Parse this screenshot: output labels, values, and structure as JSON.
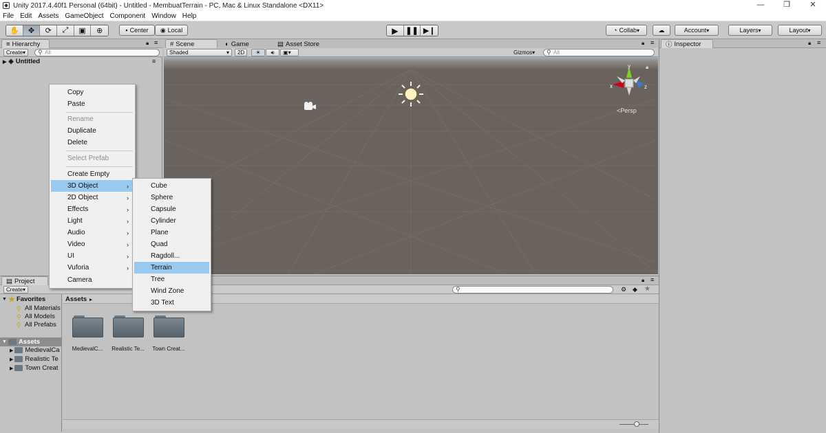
{
  "window": {
    "title": "Unity 2017.4.40f1 Personal (64bit) - Untitled - MembuatTerrain - PC, Mac & Linux Standalone <DX11>"
  },
  "menubar": [
    "File",
    "Edit",
    "Assets",
    "GameObject",
    "Component",
    "Window",
    "Help"
  ],
  "toolbar": {
    "pivot_center": "Center",
    "pivot_local": "Local",
    "collab": "Collab",
    "account": "Account",
    "layers": "Layers",
    "layout": "Layout"
  },
  "hierarchy": {
    "tab": "Hierarchy",
    "create": "Create",
    "search_placeholder": "All",
    "scene_name": "Untitled"
  },
  "scene_view": {
    "tab_scene": "Scene",
    "tab_game": "Game",
    "tab_asset_store": "Asset Store",
    "shading_mode": "Shaded",
    "mode_2d": "2D",
    "gizmos": "Gizmos",
    "search_placeholder": "All",
    "persp_label": "Persp",
    "gizmo_axes": {
      "x": "x",
      "y": "y",
      "z": "z"
    }
  },
  "inspector": {
    "tab": "Inspector"
  },
  "project": {
    "tab": "Project",
    "create": "Create",
    "favorites_label": "Favorites",
    "favorites": [
      "All Materials",
      "All Models",
      "All Prefabs"
    ],
    "assets_label": "Assets",
    "asset_tree": [
      "MedievalCa",
      "Realistic Te",
      "Town Creat"
    ],
    "breadcrumb": "Assets",
    "folders": [
      "MedievalC...",
      "Realistic Te...",
      "Town Creat..."
    ]
  },
  "context_menu": {
    "items": [
      {
        "label": "Copy"
      },
      {
        "label": "Paste"
      },
      {
        "label": "Rename",
        "disabled": true
      },
      {
        "label": "Duplicate"
      },
      {
        "label": "Delete"
      },
      {
        "label": "Select Prefab",
        "disabled": true
      },
      {
        "label": "Create Empty"
      },
      {
        "label": "3D Object",
        "submenu": true,
        "highlighted": true
      },
      {
        "label": "2D Object",
        "submenu": true
      },
      {
        "label": "Effects",
        "submenu": true
      },
      {
        "label": "Light",
        "submenu": true
      },
      {
        "label": "Audio",
        "submenu": true
      },
      {
        "label": "Video",
        "submenu": true
      },
      {
        "label": "UI",
        "submenu": true
      },
      {
        "label": "Vuforia",
        "submenu": true
      },
      {
        "label": "Camera"
      }
    ]
  },
  "submenu_3d_object": {
    "items": [
      {
        "label": "Cube"
      },
      {
        "label": "Sphere"
      },
      {
        "label": "Capsule"
      },
      {
        "label": "Cylinder"
      },
      {
        "label": "Plane"
      },
      {
        "label": "Quad"
      },
      {
        "label": "Ragdoll..."
      },
      {
        "label": "Terrain",
        "highlighted": true
      },
      {
        "label": "Tree"
      },
      {
        "label": "Wind Zone"
      },
      {
        "label": "3D Text"
      }
    ]
  },
  "colors": {
    "menu_highlight": "#99c9ef",
    "scene_ground": "#6a625c",
    "editor_bg": "#c2c2c2"
  }
}
